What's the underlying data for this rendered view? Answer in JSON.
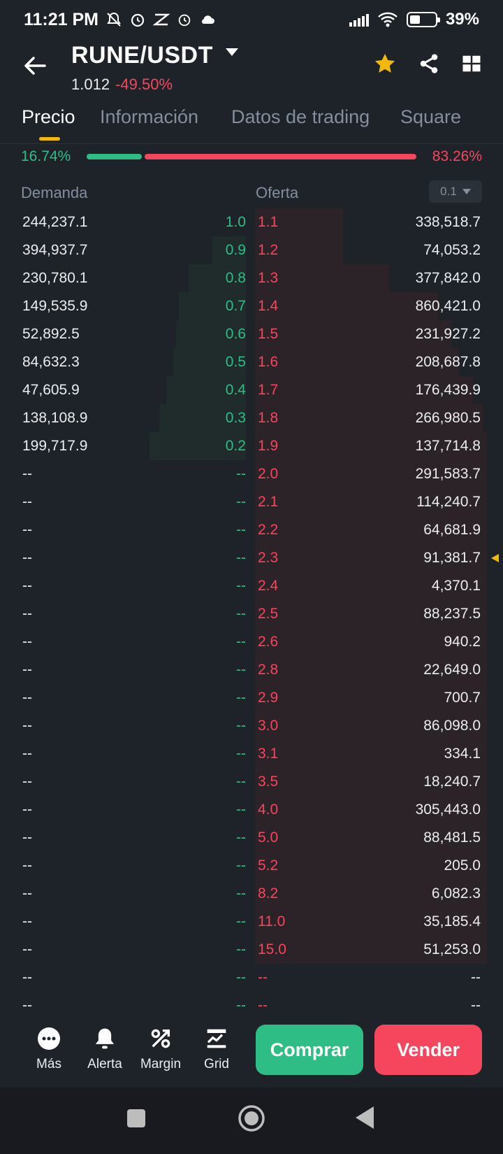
{
  "status": {
    "time": "11:21 PM",
    "battery": "39%"
  },
  "header": {
    "pair": "RUNE/USDT",
    "price": "1.012",
    "change": "-49.50%"
  },
  "tabs": [
    "Precio",
    "Información",
    "Datos de trading",
    "Square"
  ],
  "ratio": {
    "buy_pct": "16.74%",
    "sell_pct": "83.26%",
    "buy_fraction": 0.1674
  },
  "columns": {
    "bids": "Demanda",
    "asks": "Oferta",
    "step": "0.1"
  },
  "rows": [
    {
      "bid_qty": "244,237.1",
      "bid_price": "1.0",
      "ask_price": "1.1",
      "ask_qty": "338,518.7"
    },
    {
      "bid_qty": "394,937.7",
      "bid_price": "0.9",
      "ask_price": "1.2",
      "ask_qty": "74,053.2"
    },
    {
      "bid_qty": "230,780.1",
      "bid_price": "0.8",
      "ask_price": "1.3",
      "ask_qty": "377,842.0"
    },
    {
      "bid_qty": "149,535.9",
      "bid_price": "0.7",
      "ask_price": "1.4",
      "ask_qty": "860,421.0"
    },
    {
      "bid_qty": "52,892.5",
      "bid_price": "0.6",
      "ask_price": "1.5",
      "ask_qty": "231,927.2"
    },
    {
      "bid_qty": "84,632.3",
      "bid_price": "0.5",
      "ask_price": "1.6",
      "ask_qty": "208,687.8"
    },
    {
      "bid_qty": "47,605.9",
      "bid_price": "0.4",
      "ask_price": "1.7",
      "ask_qty": "176,439.9"
    },
    {
      "bid_qty": "138,108.9",
      "bid_price": "0.3",
      "ask_price": "1.8",
      "ask_qty": "266,980.5"
    },
    {
      "bid_qty": "199,717.9",
      "bid_price": "0.2",
      "ask_price": "1.9",
      "ask_qty": "137,714.8"
    },
    {
      "bid_qty": "--",
      "bid_price": "--",
      "ask_price": "2.0",
      "ask_qty": "291,583.7"
    },
    {
      "bid_qty": "--",
      "bid_price": "--",
      "ask_price": "2.1",
      "ask_qty": "114,240.7"
    },
    {
      "bid_qty": "--",
      "bid_price": "--",
      "ask_price": "2.2",
      "ask_qty": "64,681.9"
    },
    {
      "bid_qty": "--",
      "bid_price": "--",
      "ask_price": "2.3",
      "ask_qty": "91,381.7"
    },
    {
      "bid_qty": "--",
      "bid_price": "--",
      "ask_price": "2.4",
      "ask_qty": "4,370.1"
    },
    {
      "bid_qty": "--",
      "bid_price": "--",
      "ask_price": "2.5",
      "ask_qty": "88,237.5"
    },
    {
      "bid_qty": "--",
      "bid_price": "--",
      "ask_price": "2.6",
      "ask_qty": "940.2"
    },
    {
      "bid_qty": "--",
      "bid_price": "--",
      "ask_price": "2.8",
      "ask_qty": "22,649.0"
    },
    {
      "bid_qty": "--",
      "bid_price": "--",
      "ask_price": "2.9",
      "ask_qty": "700.7"
    },
    {
      "bid_qty": "--",
      "bid_price": "--",
      "ask_price": "3.0",
      "ask_qty": "86,098.0"
    },
    {
      "bid_qty": "--",
      "bid_price": "--",
      "ask_price": "3.1",
      "ask_qty": "334.1"
    },
    {
      "bid_qty": "--",
      "bid_price": "--",
      "ask_price": "3.5",
      "ask_qty": "18,240.7"
    },
    {
      "bid_qty": "--",
      "bid_price": "--",
      "ask_price": "4.0",
      "ask_qty": "305,443.0"
    },
    {
      "bid_qty": "--",
      "bid_price": "--",
      "ask_price": "5.0",
      "ask_qty": "88,481.5"
    },
    {
      "bid_qty": "--",
      "bid_price": "--",
      "ask_price": "5.2",
      "ask_qty": "205.0"
    },
    {
      "bid_qty": "--",
      "bid_price": "--",
      "ask_price": "8.2",
      "ask_qty": "6,082.3"
    },
    {
      "bid_qty": "--",
      "bid_price": "--",
      "ask_price": "11.0",
      "ask_qty": "35,185.4"
    },
    {
      "bid_qty": "--",
      "bid_price": "--",
      "ask_price": "15.0",
      "ask_qty": "51,253.0"
    },
    {
      "bid_qty": "--",
      "bid_price": "--",
      "ask_price": "--",
      "ask_qty": "--"
    },
    {
      "bid_qty": "--",
      "bid_price": "--",
      "ask_price": "--",
      "ask_qty": "--"
    }
  ],
  "toolbar": {
    "tools": [
      {
        "label": "Más",
        "icon": "more-icon"
      },
      {
        "label": "Alerta",
        "icon": "bell-icon"
      },
      {
        "label": "Margin",
        "icon": "percent-icon"
      },
      {
        "label": "Grid",
        "icon": "grid-bot-icon"
      }
    ],
    "buy_label": "Comprar",
    "sell_label": "Vender"
  },
  "colors": {
    "buy": "#2ebd85",
    "sell": "#f6465d",
    "accent": "#f0b90b",
    "bg": "#1e2329"
  }
}
